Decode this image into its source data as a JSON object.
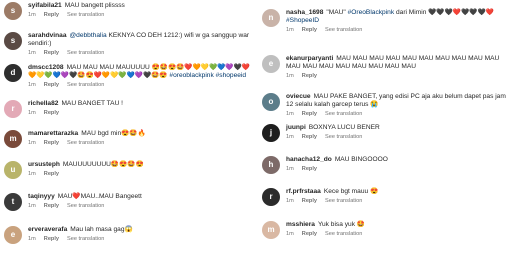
{
  "left_comments": [
    {
      "username": "syifabila21",
      "text": "MAU bangett plissss",
      "time": "1m",
      "reply": "Reply",
      "translation": "See translation",
      "avatar_color": "#9c7b66",
      "avatar_initial": "s"
    },
    {
      "username": "sarahdvinaa",
      "mention": "@debbthalia",
      "text": "KEKNYA CO DEH 1212:) wifi w ga sanggup war sendiri:)",
      "time": "1m",
      "reply": "Reply",
      "translation": "See translation",
      "avatar_color": "#5a4a44",
      "avatar_initial": "s"
    },
    {
      "username": "dmscc1208",
      "text": "MAU MAU MAU MAUUUUU 😍🤩😍🤩❤️🧡💛💚💙💜🖤❤️🧡💛💚💙💜🖤🤩😍❤️🧡💛💚💙💜🖤🤩😍",
      "hashtags": "#oreoblackpink #shopeeid",
      "time": "1m",
      "reply": "Reply",
      "translation": "See translation",
      "avatar_color": "#2e2e2e",
      "avatar_initial": "d"
    },
    {
      "username": "richella82",
      "text": "MAU BANGET TAU !",
      "time": "1m",
      "reply": "Reply",
      "avatar_color": "#e3a9b6",
      "avatar_initial": "r"
    },
    {
      "username": "mamarettarazka",
      "text": "MAU bgd min😍🤩🔥",
      "time": "1m",
      "reply": "Reply",
      "translation": "See translation",
      "avatar_color": "#7a4a3a",
      "avatar_initial": "m"
    },
    {
      "username": "ursusteph",
      "text": "MAUUUUUUUU🤩😍🤩😍",
      "time": "1m",
      "reply": "Reply",
      "avatar_color": "#b9b46a",
      "avatar_initial": "u"
    },
    {
      "username": "taqinyyy",
      "text": "MAU❤️MAU..MAU Bangeett",
      "time": "1m",
      "reply": "Reply",
      "translation": "See translation",
      "avatar_color": "#3a3a3a",
      "avatar_initial": "t"
    },
    {
      "username": "erveraverafa",
      "text": "Mau lah masa gag😱",
      "time": "1m",
      "reply": "Reply",
      "translation": "See translation",
      "avatar_color": "#c9a27e",
      "avatar_initial": "e"
    }
  ],
  "right_comments": [
    {
      "username": "nasha_1698",
      "text_before": "\"MAU\"",
      "hashtags": "#OreoBlackpink",
      "text_after": "dari Mimin 🖤🖤🖤❤️🖤🖤🖤❤️",
      "hashtags2": "#ShopeeID",
      "time": "1m",
      "reply": "Reply",
      "translation": "See translation",
      "avatar_color": "#c9b3a8",
      "avatar_initial": "n"
    },
    {
      "username": "ekanurparyanti",
      "text": "MAU MAU MAU MAU MAU MAU MAU MAU MAU MAU MAU MAU MAU MAU MAU MAU MAU MAU",
      "time": "1m",
      "reply": "Reply",
      "avatar_color": "#bfbfbf",
      "avatar_initial": "e"
    },
    {
      "username": "oviecue",
      "text": "MAU PAKE BANGET, yang edisi PC aja aku belum dapet pas jam 12 selalu kalah garcep terus 😭",
      "time": "1m",
      "reply": "Reply",
      "translation": "See translation",
      "avatar_color": "#5c7d8a",
      "avatar_initial": "o"
    },
    {
      "username": "juunpi",
      "text": "BOXNYA LUCU BENER",
      "time": "1m",
      "reply": "Reply",
      "translation": "See translation",
      "avatar_color": "#1e1e1e",
      "avatar_initial": "j"
    },
    {
      "username": "hanacha12_do",
      "text": "MAU BINGOOOO",
      "time": "1m",
      "reply": "Reply",
      "avatar_color": "#7d6a68",
      "avatar_initial": "h"
    },
    {
      "username": "rf.prfrstaaa",
      "text": "Kece bgt mauu 😍",
      "time": "1m",
      "reply": "Reply",
      "translation": "See translation",
      "avatar_color": "#2b2b2b",
      "avatar_initial": "r"
    },
    {
      "username": "msshiera",
      "text": "Yuk bisa yuk 🤩",
      "time": "1m",
      "reply": "Reply",
      "translation": "See translation",
      "avatar_color": "#d9b8a3",
      "avatar_initial": "m"
    }
  ]
}
